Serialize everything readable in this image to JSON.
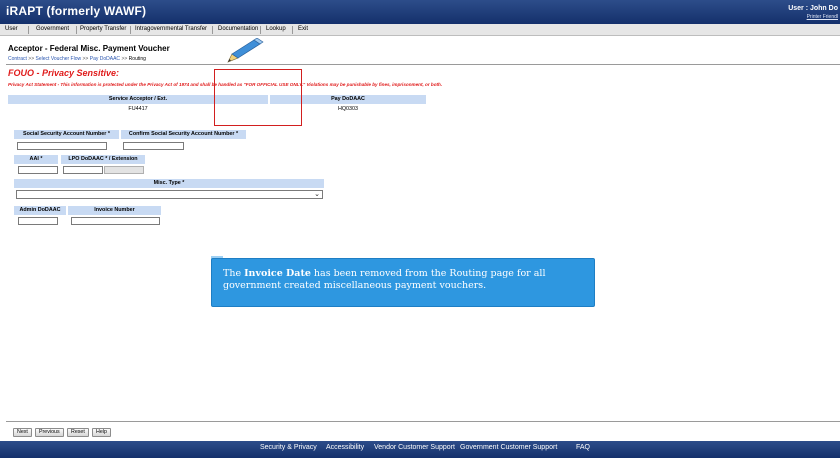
{
  "header": {
    "app_title": "iRAPT (formerly WAWF)",
    "user_label": "User : John Do",
    "printer_friendly": "Printer Friendl"
  },
  "menu": {
    "items": [
      "User",
      "Government",
      "Property Transfer",
      "Intragovernmental Transfer",
      "Documentation",
      "Lookup",
      "Exit"
    ]
  },
  "page": {
    "title": "Acceptor - Federal Misc. Payment Voucher",
    "breadcrumb": {
      "link1": "Contract",
      "sep1": ">>",
      "link2": "Select Voucher Flow",
      "sep2": ">>",
      "link3": "Pay DoDAAC",
      "sep3": ">>",
      "current": "Routing"
    },
    "fouo": "FOUO - Privacy Sensitive:",
    "privacy_statement": "Privacy Act Statement - This information is protected under the Privacy Act of 1974 and shall be handled as \"FOR OFFICIAL USE ONLY.\" Violations may be punishable by fines, imprisonment, or both."
  },
  "routing": {
    "service_acceptor_header": "Service Acceptor / Ext.",
    "service_acceptor_value": "FU4417",
    "pay_dodaac_header": "Pay DoDAAC",
    "pay_dodaac_value": "HQ0303"
  },
  "form": {
    "ssn_label": "Social Security Account Number *",
    "ssn_value": "",
    "confirm_ssn_label": "Confirm Social Security Account Number *",
    "confirm_ssn_value": "",
    "aai_label": "AAI *",
    "aai_value": "",
    "lpo_label": "LPO DoDAAC * / Extension",
    "lpo_value": "",
    "lpo_ext_value": "",
    "misc_type_label": "Misc. Type *",
    "misc_type_value": "",
    "admin_dodaac_label": "Admin DoDAAC",
    "admin_dodaac_value": "",
    "invoice_number_label": "Invoice Number",
    "invoice_number_value": ""
  },
  "callout": {
    "prefix": "The ",
    "bold": "Invoice Date",
    "suffix": " has been removed from the Routing page for all government created miscellaneous payment vouchers."
  },
  "buttons": {
    "next": "Next",
    "previous": "Previous",
    "reset": "Reset",
    "help": "Help"
  },
  "footer": {
    "links": [
      "Security & Privacy",
      "Accessibility",
      "Vendor Customer Support",
      "Government Customer Support",
      "FAQ"
    ]
  },
  "colors": {
    "brand_navy": "#14306b",
    "header_blue": "#c8daf3",
    "alert_red": "#e01b1b",
    "callout_blue": "#2e97e0",
    "link_blue": "#2a56b0"
  }
}
